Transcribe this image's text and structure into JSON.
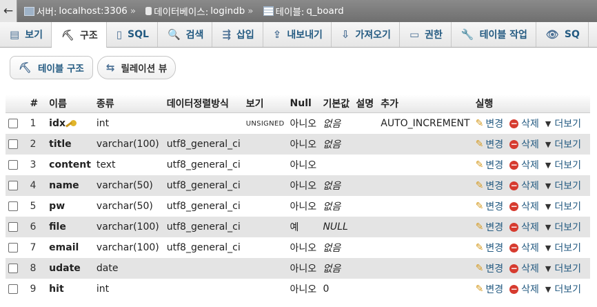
{
  "breadcrumb": {
    "back": "←",
    "server_label": "서버:",
    "server": "localhost:3306",
    "db_label": "데이터베이스:",
    "db": "logindb",
    "table_label": "테이블:",
    "table": "q_board",
    "separator": "»"
  },
  "tabs": [
    {
      "label": "보기",
      "icon": "browse-icon",
      "glyph": "▤"
    },
    {
      "label": "구조",
      "icon": "structure-icon",
      "glyph": "⛏"
    },
    {
      "label": "SQL",
      "icon": "sql-icon",
      "glyph": "▯"
    },
    {
      "label": "검색",
      "icon": "search-icon",
      "glyph": "🔍"
    },
    {
      "label": "삽입",
      "icon": "insert-icon",
      "glyph": "⇶"
    },
    {
      "label": "내보내기",
      "icon": "export-icon",
      "glyph": "⇪"
    },
    {
      "label": "가져오기",
      "icon": "import-icon",
      "glyph": "⇩"
    },
    {
      "label": "권한",
      "icon": "privileges-icon",
      "glyph": "▭"
    },
    {
      "label": "테이블 작업",
      "icon": "wrench-icon",
      "glyph": "🔧"
    },
    {
      "label": "SQ",
      "icon": "eye-icon",
      "glyph": "👁"
    }
  ],
  "subnav": {
    "structure": "테이블 구조",
    "relation": "릴레이션 뷰"
  },
  "columns": [
    "#",
    "이름",
    "종류",
    "데이터정렬방식",
    "보기",
    "Null",
    "기본값",
    "설명",
    "추가",
    "실행"
  ],
  "actions": {
    "edit": "변경",
    "delete": "삭제",
    "more": "더보기"
  },
  "rows": [
    {
      "n": "1",
      "name": "idx",
      "type": "int",
      "collation": "",
      "attr": "UNSIGNED",
      "null": "아니오",
      "default": "없음",
      "extra": "AUTO_INCREMENT"
    },
    {
      "n": "2",
      "name": "title",
      "type": "varchar(100)",
      "collation": "utf8_general_ci",
      "attr": "",
      "null": "아니오",
      "default": "없음",
      "extra": ""
    },
    {
      "n": "3",
      "name": "content",
      "type": "text",
      "collation": "utf8_general_ci",
      "attr": "",
      "null": "아니오",
      "default": "",
      "extra": ""
    },
    {
      "n": "4",
      "name": "name",
      "type": "varchar(50)",
      "collation": "utf8_general_ci",
      "attr": "",
      "null": "아니오",
      "default": "없음",
      "extra": ""
    },
    {
      "n": "5",
      "name": "pw",
      "type": "varchar(50)",
      "collation": "utf8_general_ci",
      "attr": "",
      "null": "아니오",
      "default": "없음",
      "extra": ""
    },
    {
      "n": "6",
      "name": "file",
      "type": "varchar(100)",
      "collation": "utf8_general_ci",
      "attr": "",
      "null": "예",
      "default": "NULL",
      "extra": ""
    },
    {
      "n": "7",
      "name": "email",
      "type": "varchar(100)",
      "collation": "utf8_general_ci",
      "attr": "",
      "null": "아니오",
      "default": "없음",
      "extra": ""
    },
    {
      "n": "8",
      "name": "udate",
      "type": "date",
      "collation": "",
      "attr": "",
      "null": "아니오",
      "default": "없음",
      "extra": ""
    },
    {
      "n": "9",
      "name": "hit",
      "type": "int",
      "collation": "",
      "attr": "",
      "null": "아니오",
      "default": "0",
      "extra": ""
    }
  ]
}
